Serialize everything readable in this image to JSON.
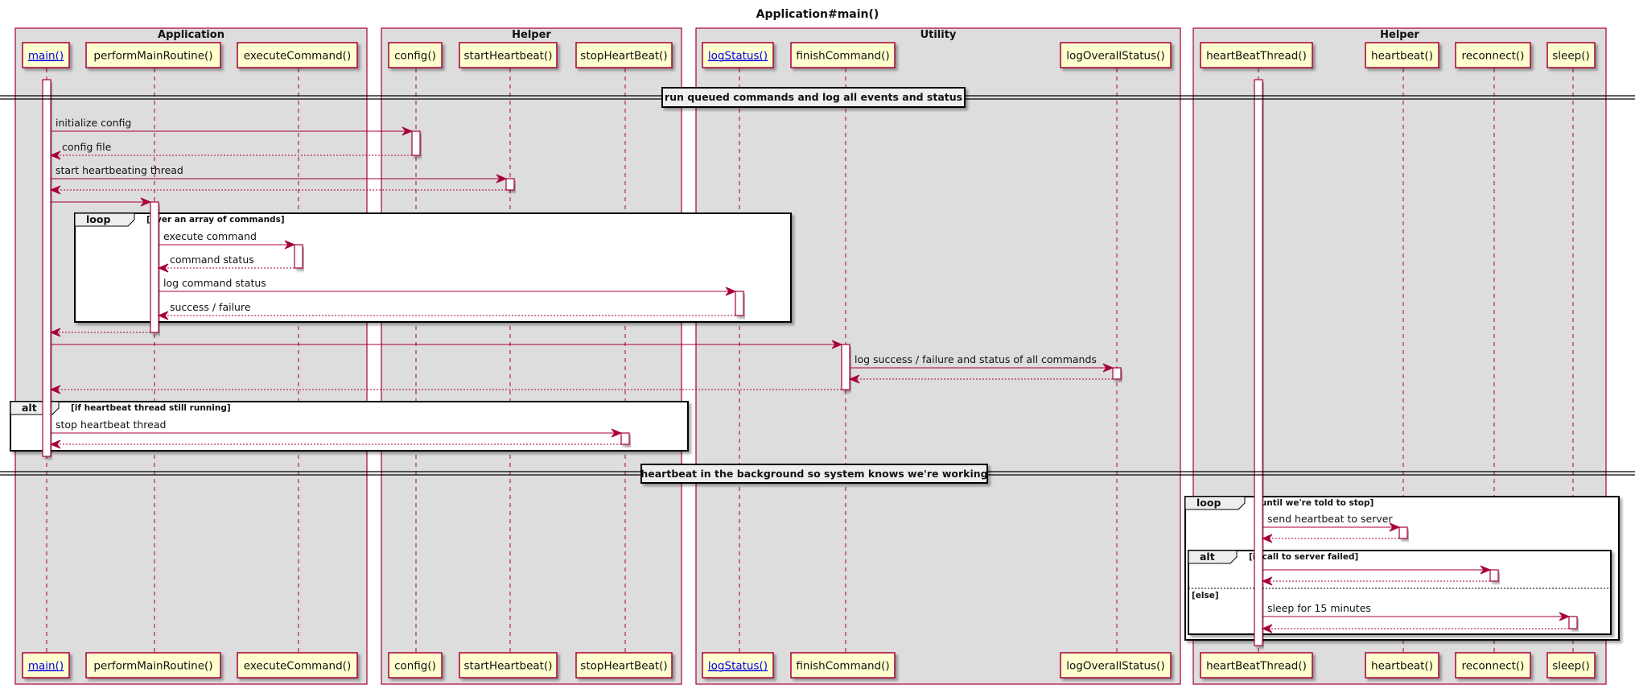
{
  "diagram": {
    "type": "sequence",
    "title": "Application#main()",
    "colors": {
      "line": "#a80036",
      "participant_fill": "#fefece",
      "group_fill": "#dddddd",
      "frame_border": "#000000",
      "link": "#0000ee"
    },
    "groups": [
      {
        "id": "g1",
        "label": "Application"
      },
      {
        "id": "g2",
        "label": "Helper"
      },
      {
        "id": "g3",
        "label": "Utility"
      },
      {
        "id": "g4",
        "label": "Helper"
      }
    ],
    "participants": [
      {
        "id": "main",
        "label": "main()",
        "link": true,
        "group": "g1"
      },
      {
        "id": "pmr",
        "label": "performMainRoutine()",
        "link": false,
        "group": "g1"
      },
      {
        "id": "exec",
        "label": "executeCommand()",
        "link": false,
        "group": "g1"
      },
      {
        "id": "config",
        "label": "config()",
        "link": false,
        "group": "g2"
      },
      {
        "id": "startHb",
        "label": "startHeartbeat()",
        "link": false,
        "group": "g2"
      },
      {
        "id": "stopHb",
        "label": "stopHeartBeat()",
        "link": false,
        "group": "g2"
      },
      {
        "id": "logStatus",
        "label": "logStatus()",
        "link": true,
        "group": "g3"
      },
      {
        "id": "finish",
        "label": "finishCommand()",
        "link": false,
        "group": "g3"
      },
      {
        "id": "logOverall",
        "label": "logOverallStatus()",
        "link": false,
        "group": "g3"
      },
      {
        "id": "hbThread",
        "label": "heartBeatThread()",
        "link": false,
        "group": "g4"
      },
      {
        "id": "heartbeat",
        "label": "heartbeat()",
        "link": false,
        "group": "g4"
      },
      {
        "id": "reconnect",
        "label": "reconnect()",
        "link": false,
        "group": "g4"
      },
      {
        "id": "sleep",
        "label": "sleep()",
        "link": false,
        "group": "g4"
      }
    ],
    "dividers": [
      {
        "label": "run queued commands and log all events and status"
      },
      {
        "label": "heartbeat in the background so system knows we're working"
      }
    ],
    "messages": [
      {
        "from": "main",
        "to": "config",
        "label": "initialize config",
        "kind": "call"
      },
      {
        "from": "config",
        "to": "main",
        "label": "config file",
        "kind": "return"
      },
      {
        "from": "main",
        "to": "startHb",
        "label": "start heartbeating thread",
        "kind": "call"
      },
      {
        "from": "startHb",
        "to": "main",
        "label": "",
        "kind": "return"
      },
      {
        "from": "main",
        "to": "pmr",
        "label": "",
        "kind": "call"
      },
      {
        "from": "pmr",
        "to": "exec",
        "label": "execute command",
        "kind": "call"
      },
      {
        "from": "exec",
        "to": "pmr",
        "label": "command status",
        "kind": "return"
      },
      {
        "from": "pmr",
        "to": "logStatus",
        "label": "log command status",
        "kind": "call"
      },
      {
        "from": "logStatus",
        "to": "pmr",
        "label": "success / failure",
        "kind": "return"
      },
      {
        "from": "pmr",
        "to": "main",
        "label": "",
        "kind": "return"
      },
      {
        "from": "main",
        "to": "finish",
        "label": "",
        "kind": "call"
      },
      {
        "from": "finish",
        "to": "logOverall",
        "label": "log success / failure and status of all commands",
        "kind": "call"
      },
      {
        "from": "logOverall",
        "to": "finish",
        "label": "",
        "kind": "return"
      },
      {
        "from": "finish",
        "to": "main",
        "label": "",
        "kind": "return"
      },
      {
        "from": "main",
        "to": "stopHb",
        "label": "stop heartbeat thread",
        "kind": "call"
      },
      {
        "from": "stopHb",
        "to": "main",
        "label": "",
        "kind": "return"
      },
      {
        "from": "hbThread",
        "to": "heartbeat",
        "label": "send heartbeat to server",
        "kind": "call"
      },
      {
        "from": "heartbeat",
        "to": "hbThread",
        "label": "",
        "kind": "return"
      },
      {
        "from": "hbThread",
        "to": "reconnect",
        "label": "",
        "kind": "call"
      },
      {
        "from": "reconnect",
        "to": "hbThread",
        "label": "",
        "kind": "return"
      },
      {
        "from": "hbThread",
        "to": "sleep",
        "label": "sleep for 15 minutes",
        "kind": "call"
      },
      {
        "from": "sleep",
        "to": "hbThread",
        "label": "",
        "kind": "return"
      }
    ],
    "frames": [
      {
        "keyword": "loop",
        "condition": "[over an array of commands]",
        "else": ""
      },
      {
        "keyword": "alt",
        "condition": "[if heartbeat thread still running]",
        "else": ""
      },
      {
        "keyword": "loop",
        "condition": "[until we're told to stop]",
        "else": ""
      },
      {
        "keyword": "alt",
        "condition": "[if call to server failed]",
        "else": "[else]"
      }
    ]
  }
}
